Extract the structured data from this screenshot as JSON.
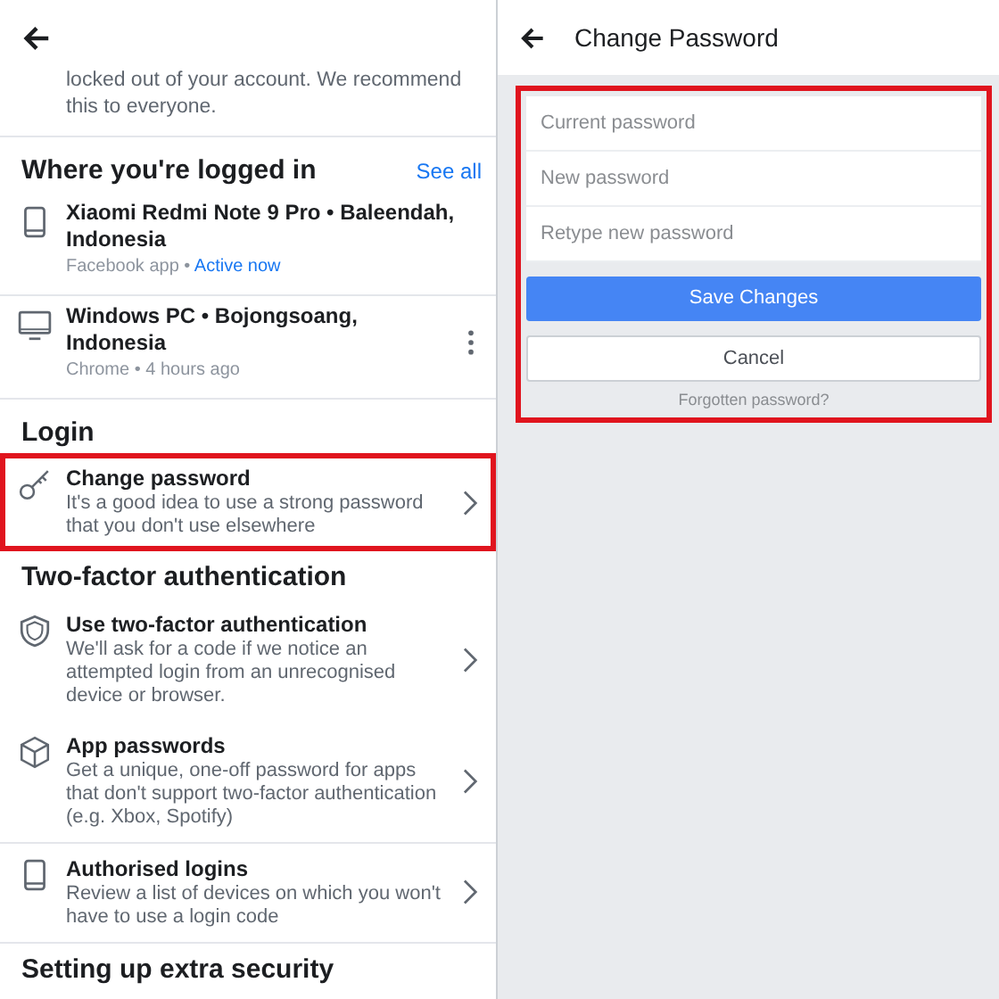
{
  "left_panel": {
    "intro_text": "locked out of your account. We recommend this to everyone.",
    "logged_in": {
      "heading": "Where you're logged in",
      "see_all": "See all",
      "devices": [
        {
          "kind": "phone",
          "name": "Xiaomi Redmi Note 9 Pro • Baleendah, Indonesia",
          "app": "Facebook app",
          "separator": "•",
          "status": "Active now",
          "menu": false
        },
        {
          "kind": "desktop",
          "name": "Windows PC • Bojongsoang, Indonesia",
          "app": "Chrome",
          "separator": "•",
          "status": "4 hours ago",
          "menu": true
        }
      ]
    },
    "sections": [
      {
        "heading": "Login",
        "items": [
          {
            "kind": "key",
            "title": "Change password",
            "description": "It's a good idea to use a strong password that you don't use elsewhere",
            "highlighted": true
          }
        ]
      },
      {
        "heading": "Two-factor authentication",
        "items": [
          {
            "kind": "shield",
            "title": "Use two-factor authentication",
            "description": "We'll ask for a code if we notice an attempted login from an unrecognised device or browser.",
            "highlighted": false
          },
          {
            "kind": "cube",
            "title": "App passwords",
            "description": "Get a unique, one-off password for apps that don't support two-factor authentication (e.g. Xbox, Spotify)",
            "highlighted": false
          },
          {
            "kind": "phone",
            "title": "Authorised logins",
            "description": "Review a list of devices on which you won't have to use a login code",
            "highlighted": false
          }
        ]
      },
      {
        "heading": "Setting up extra security"
      }
    ]
  },
  "right_panel": {
    "title": "Change Password",
    "highlighted": true,
    "fields": [
      {
        "placeholder": "Current password"
      },
      {
        "placeholder": "New password"
      },
      {
        "placeholder": "Retype new password"
      }
    ],
    "save_button": "Save Changes",
    "cancel_button": "Cancel",
    "forgot_link": "Forgotten password?"
  }
}
